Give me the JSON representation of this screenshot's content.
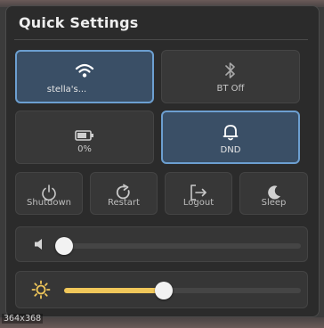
{
  "panel": {
    "title": "Quick Settings"
  },
  "toggles": [
    {
      "key": "wifi",
      "label": "stella's...",
      "icon": "wifi-icon",
      "active": true
    },
    {
      "key": "bluetooth",
      "label": "BT Off",
      "icon": "bluetooth-icon",
      "active": false
    },
    {
      "key": "battery",
      "label": "0%",
      "icon": "battery-icon",
      "active": false
    },
    {
      "key": "dnd",
      "label": "DND",
      "icon": "bell-icon",
      "active": true
    }
  ],
  "power": [
    {
      "key": "shutdown",
      "label": "Shutdown",
      "icon": "power-icon"
    },
    {
      "key": "restart",
      "label": "Restart",
      "icon": "restart-icon"
    },
    {
      "key": "logout",
      "label": "Logout",
      "icon": "logout-icon"
    },
    {
      "key": "sleep",
      "label": "Sleep",
      "icon": "moon-icon"
    }
  ],
  "sliders": {
    "volume": {
      "icon": "speaker-icon",
      "value_percent": 0
    },
    "brightness": {
      "icon": "sun-icon",
      "value_percent": 42
    }
  },
  "colors": {
    "accent": "#6c9fd0",
    "active_tile": "#3a4f66",
    "slider_fill": "#f0c75a",
    "brightness_icon": "#f0c75a"
  },
  "screenshot_size_label": "364x368"
}
